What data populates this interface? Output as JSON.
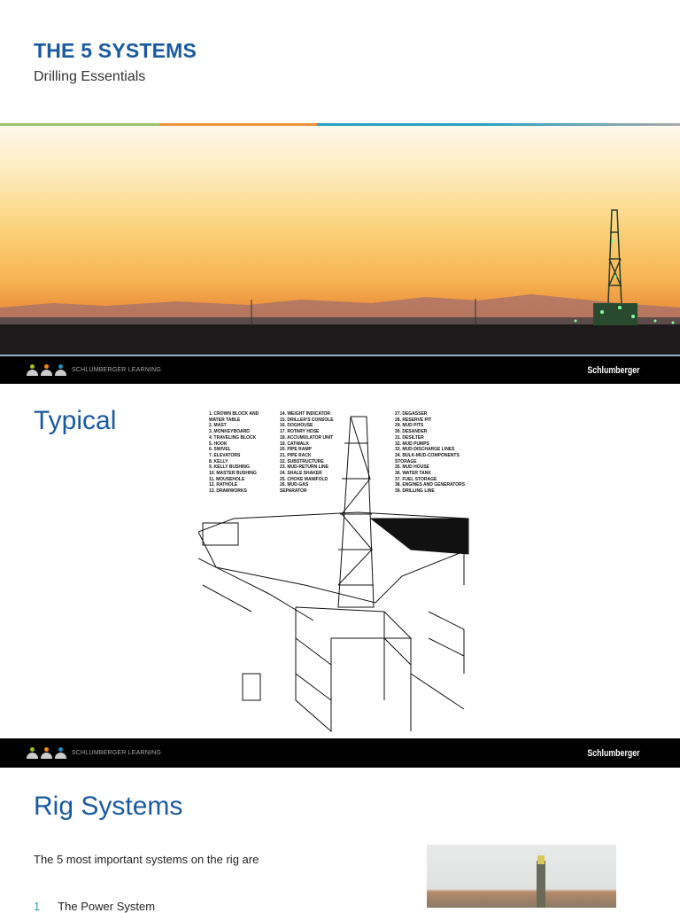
{
  "header": {
    "title": "THE 5 SYSTEMS",
    "subtitle": "Drilling Essentials"
  },
  "footer": {
    "learning_label": "SCHLUMBERGER LEARNING",
    "brand": "Schlumberger",
    "colors": [
      "#9bc21a",
      "#ef8a1e",
      "#1a90c0"
    ]
  },
  "slide2": {
    "title": "Typical",
    "legend": [
      [
        "1. CROWN BLOCK AND",
        "   WATER TABLE",
        "2. MAST",
        "3. MONKEYBOARD",
        "4. TRAVELING BLOCK",
        "5. HOOK",
        "6. SWIVEL",
        "7. ELEVATORS",
        "8. KELLY",
        "9. KELLY BUSHING",
        "10. MASTER BUSHING",
        "11. MOUSEHOLE",
        "12. RATHOLE",
        "13. DRAWWORKS"
      ],
      [
        "14. WEIGHT INDICATOR",
        "15. DRILLER'S CONSOLE",
        "16. DOGHOUSE",
        "17. ROTARY HOSE",
        "18. ACCUMULATOR UNIT",
        "19. CATWALK",
        "20. PIPE RAMP",
        "21. PIPE RACK",
        "22. SUBSTRUCTURE",
        "23. MUD-RETURN LINE",
        "24. SHALE SHAKER",
        "25. CHOKE MANIFOLD",
        "26. MUD-GAS",
        "    SEPARATOR"
      ],
      [
        "27. DEGASSER",
        "28. RESERVE PIT",
        "29. MUD PITS",
        "30. DESANDER",
        "31. DESILTER",
        "32. MUD PUMPS",
        "33. MUD-DISCHARGE LINES",
        "34. BULK-MUD-COMPONENTS",
        "    STORAGE",
        "35. MUD HOUSE",
        "36. WATER TANK",
        "37. FUEL STORAGE",
        "38. ENGINES AND GENERATORS",
        "39. DRILLING LINE"
      ]
    ]
  },
  "slide3": {
    "title": "Rig Systems",
    "intro": "The 5 most important systems on the rig are",
    "list": [
      {
        "num": "1",
        "label": "The Power System"
      }
    ]
  }
}
